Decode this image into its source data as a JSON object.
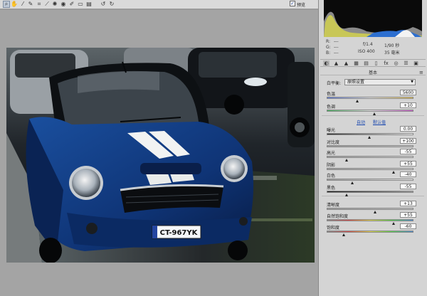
{
  "toolbar": {
    "tools": [
      "zoom-icon",
      "hand-icon",
      "white-balance-icon",
      "color-sampler-icon",
      "crop-icon",
      "straighten-icon",
      "spot-removal-icon",
      "red-eye-icon",
      "adjustment-brush-icon",
      "graduated-filter-icon",
      "preferences-icon",
      "rotate-left-icon",
      "rotate-right-icon"
    ],
    "preview_label": "预览",
    "preview_checked": true
  },
  "readout": {
    "r_label": "R:",
    "r_value": "---",
    "g_label": "G:",
    "g_value": "---",
    "b_label": "B:",
    "b_value": "---",
    "aperture": "f/1.4",
    "shutter": "1/90 秒",
    "iso": "ISO 400",
    "focal": "35 毫米"
  },
  "panel": {
    "section_title": "基本",
    "white_balance": {
      "label": "白平衡:",
      "value": "原照设置"
    },
    "sliders": [
      {
        "label": "色温",
        "value": "5600",
        "position": 0.36,
        "group": "wb"
      },
      {
        "label": "色调",
        "value": "+10",
        "position": 0.56,
        "group": "wb"
      },
      {
        "label": "曝光",
        "value": "0.00",
        "position": 0.5,
        "group": "tone"
      },
      {
        "label": "对比度",
        "value": "+100",
        "position": 1.0,
        "group": "tone"
      },
      {
        "label": "高光",
        "value": "-55",
        "position": 0.23,
        "group": "tone"
      },
      {
        "label": "阴影",
        "value": "+55",
        "position": 0.78,
        "group": "tone"
      },
      {
        "label": "白色",
        "value": "-40",
        "position": 0.3,
        "group": "tone"
      },
      {
        "label": "黑色",
        "value": "-55",
        "position": 0.23,
        "group": "tone"
      },
      {
        "label": "清晰度",
        "value": "+13",
        "position": 0.57,
        "group": "presence"
      },
      {
        "label": "自然饱和度",
        "value": "+55",
        "position": 0.78,
        "group": "presence"
      },
      {
        "label": "饱和度",
        "value": "-60",
        "position": 0.2,
        "group": "presence"
      }
    ],
    "auto_label": "自动",
    "default_label": "默认值"
  },
  "photo": {
    "license_plate": "CT-967YK"
  },
  "colors": {
    "accent": "#1f4bb0",
    "car_blue": "#123a7e",
    "panel_bg": "#d4d4d4"
  }
}
